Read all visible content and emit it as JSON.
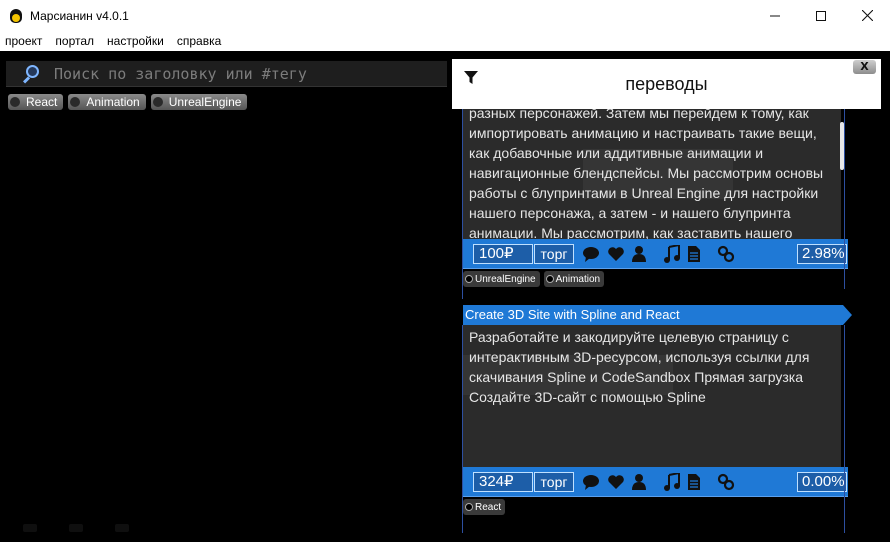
{
  "window": {
    "title": "Марсианин v4.0.1",
    "controls": {
      "minimize": "minimize-icon",
      "maximize": "maximize-icon",
      "close": "close-icon"
    }
  },
  "menu": [
    "проект",
    "портал",
    "настройки",
    "справка"
  ],
  "search": {
    "placeholder": "Поиск по заголовку или #тегу"
  },
  "filter_tags": [
    "React",
    "Animation",
    "UnrealEngine"
  ],
  "panel": {
    "title": "переводы",
    "close_label": "X"
  },
  "cards": [
    {
      "title": "",
      "description": "разных персонажей. Затем мы перейдем к тому, как импортировать анимацию и настраивать такие вещи, как добавочные или аддитивные анимации и навигационные блендспейсы. Мы рассмотрим основы работы с блупринтами в Unreal Engine для настройки нашего персонажа, а затем - и нашего блупринта анимации. Мы рассмотрим, как заставить нашего",
      "price": "100₽",
      "bargain": "торг",
      "percent": "2.98%",
      "tags": [
        "UnrealEngine",
        "Animation"
      ]
    },
    {
      "title": "Create 3D Site with Spline and React",
      "description": "Разработайте и закодируйте целевую страницу с интерактивным 3D-ресурсом, используя ссылки для скачивания Spline и CodeSandbox Прямая загрузка Создайте 3D-сайт с помощью Spline",
      "price": "324₽",
      "bargain": "торг",
      "percent": "0.00%",
      "tags": [
        "React"
      ]
    }
  ],
  "toolbar_icons": [
    "comment-icon",
    "heart-icon",
    "user-icon",
    "music-icon",
    "document-icon",
    "link-icon"
  ],
  "colors": {
    "accent": "#1f79d6",
    "card_bg": "#2b2b2b",
    "app_bg": "#000000"
  }
}
